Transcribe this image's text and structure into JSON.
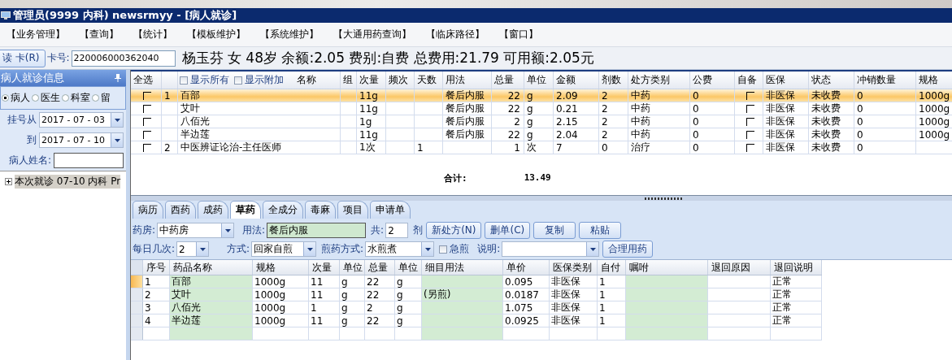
{
  "window": {
    "title": "管理员(9999 内科) newsrmyy - [病人就诊]"
  },
  "menu": [
    "【业务管理】",
    "【查询】",
    "【统计】",
    "【模板维护】",
    "【系统维护】",
    "【大通用药查询】",
    "【临床路径】",
    "【窗口】"
  ],
  "card_bar": {
    "read_button": "读 卡(R)",
    "card_label": "卡号:",
    "card_number": "220006000362040",
    "patient_info": "杨玉芬 女 48岁 余额:2.05 费别:自费 总费用:21.79 可用额:2.05元"
  },
  "left_panel": {
    "title": "病人就诊信息",
    "radios": [
      {
        "label": "病人",
        "selected": true
      },
      {
        "label": "医生",
        "selected": false
      },
      {
        "label": "科室",
        "selected": false
      },
      {
        "label": "留",
        "selected": false
      }
    ],
    "from_label": "挂号从",
    "from_date": "2017 - 07 - 03",
    "to_label": "到",
    "to_date": "2017 - 07 - 10",
    "name_label": "病人姓名:",
    "tree": [
      {
        "label": "本次就诊 07-10 内科 Pr",
        "expanded": false
      }
    ]
  },
  "orders": {
    "header_checks": [
      {
        "label": "显示所有",
        "checked": false
      },
      {
        "label": "显示附加",
        "checked": false
      }
    ],
    "columns": [
      {
        "label": "全选",
        "kind": "check"
      },
      {
        "kind": "text"
      },
      {
        "label": "名称",
        "kind": "name"
      },
      {
        "label": "组",
        "kind": "text"
      },
      {
        "label": "次量",
        "kind": "text"
      },
      {
        "label": "频次",
        "kind": "text"
      },
      {
        "label": "天数",
        "kind": "text"
      },
      {
        "label": "用法",
        "kind": "text"
      },
      {
        "label": "总量",
        "kind": "num"
      },
      {
        "label": "单位",
        "kind": "text"
      },
      {
        "label": "金额",
        "kind": "text"
      },
      {
        "label": "剂数",
        "kind": "text"
      },
      {
        "label": "处方类别",
        "kind": "text"
      },
      {
        "label": "公费",
        "kind": "text"
      },
      {
        "label": "自备",
        "kind": "check"
      },
      {
        "label": "医保",
        "kind": "text"
      },
      {
        "label": "状态",
        "kind": "text"
      },
      {
        "label": "冲销数量",
        "kind": "text"
      },
      {
        "label": "规格",
        "kind": "text"
      }
    ],
    "rows": [
      {
        "selected": true,
        "cells": [
          {
            "checked": false
          },
          "1",
          "百部",
          null,
          "11g",
          null,
          null,
          "餐后内服",
          "22",
          "g",
          "2.09",
          "2",
          "中药",
          "0",
          {
            "checked": false
          },
          "非医保",
          "未收费",
          "0",
          "1000g"
        ]
      },
      {
        "selected": false,
        "cells": [
          {
            "checked": false
          },
          null,
          "艾叶",
          null,
          "11g",
          null,
          null,
          "餐后内服",
          "22",
          "g",
          "0.21",
          "2",
          "中药",
          "0",
          {
            "checked": false
          },
          "非医保",
          "未收费",
          "0",
          "1000g"
        ]
      },
      {
        "selected": false,
        "cells": [
          {
            "checked": false
          },
          null,
          "八佰光",
          null,
          "1g",
          null,
          null,
          "餐后内服",
          "2",
          "g",
          "2.15",
          "2",
          "中药",
          "0",
          {
            "checked": false
          },
          "非医保",
          "未收费",
          "0",
          "1000g"
        ]
      },
      {
        "selected": false,
        "cells": [
          {
            "checked": false
          },
          null,
          "半边莲",
          null,
          "11g",
          null,
          null,
          "餐后内服",
          "22",
          "g",
          "2.04",
          "2",
          "中药",
          "0",
          {
            "checked": false
          },
          "非医保",
          "未收费",
          "0",
          "1000g"
        ]
      },
      {
        "selected": false,
        "cells": [
          {
            "checked": false
          },
          "2",
          "中医辨证论治-主任医师",
          null,
          "1次",
          null,
          "1",
          null,
          "1",
          "次",
          "7",
          "0",
          "治疗",
          "0",
          {
            "checked": false
          },
          "非医保",
          "未收费",
          "0",
          null
        ]
      }
    ],
    "total_label": "合计:",
    "total": "13.49"
  },
  "tabs": [
    {
      "label": "病历",
      "selected": false
    },
    {
      "label": "西药",
      "selected": false
    },
    {
      "label": "成药",
      "selected": false
    },
    {
      "label": "草药",
      "selected": true
    },
    {
      "label": "全成分",
      "selected": false
    },
    {
      "label": "毒麻",
      "selected": false
    },
    {
      "label": "项目",
      "selected": false
    },
    {
      "label": "申请单",
      "selected": false
    }
  ],
  "form": {
    "pharmacy_label": "药房:",
    "pharmacy": "中药房",
    "usage_label": "用法:",
    "usage": "餐后内服",
    "count_label": "共:",
    "count": "2",
    "count_unit": "剂",
    "buttons": [
      "新处方(N)",
      "删单(C)",
      "复制",
      "粘贴"
    ],
    "times_label": "每日几次:",
    "times": "2",
    "method_label": "方式:",
    "method": "回家自煎",
    "decoct_label": "煎药方式:",
    "decoct": "水煎煮",
    "urgent": {
      "label": "急煎",
      "checked": false
    },
    "note_label": "说明:",
    "check_button": "合理用药"
  },
  "herbs": {
    "columns": [
      {
        "label": "序号",
        "kind": "text"
      },
      {
        "label": "药品名称",
        "kind": "edit"
      },
      {
        "label": "规格",
        "kind": "text"
      },
      {
        "label": "次量",
        "kind": "text"
      },
      {
        "label": "单位",
        "kind": "text"
      },
      {
        "label": "总量",
        "kind": "text"
      },
      {
        "label": "单位",
        "kind": "text"
      },
      {
        "label": "细目用法",
        "kind": "edit"
      },
      {
        "label": "单价",
        "kind": "text"
      },
      {
        "label": "医保类别",
        "kind": "text"
      },
      {
        "label": "自付",
        "kind": "text"
      },
      {
        "label": "嘱咐",
        "kind": "edit"
      },
      {
        "label": "退回原因",
        "kind": "text"
      },
      {
        "label": "退回说明",
        "kind": "text"
      }
    ],
    "rows": [
      {
        "selected": true,
        "cells": [
          "1",
          "百部",
          "1000g",
          "11",
          "g",
          "22",
          "g",
          null,
          "0.095",
          "非医保",
          "1",
          null,
          null,
          "正常"
        ]
      },
      {
        "selected": false,
        "cells": [
          "2",
          "艾叶",
          "1000g",
          "11",
          "g",
          "22",
          "g",
          "(另煎)",
          "0.0187",
          "非医保",
          "1",
          null,
          null,
          "正常"
        ]
      },
      {
        "selected": false,
        "cells": [
          "3",
          "八佰光",
          "1000g",
          "1",
          "g",
          "2",
          "g",
          null,
          "1.075",
          "非医保",
          "1",
          null,
          null,
          "正常"
        ]
      },
      {
        "selected": false,
        "cells": [
          "4",
          "半边莲",
          "1000g",
          "11",
          "g",
          "22",
          "g",
          null,
          "0.0925",
          "非医保",
          "1",
          null,
          null,
          "正常"
        ]
      }
    ]
  }
}
